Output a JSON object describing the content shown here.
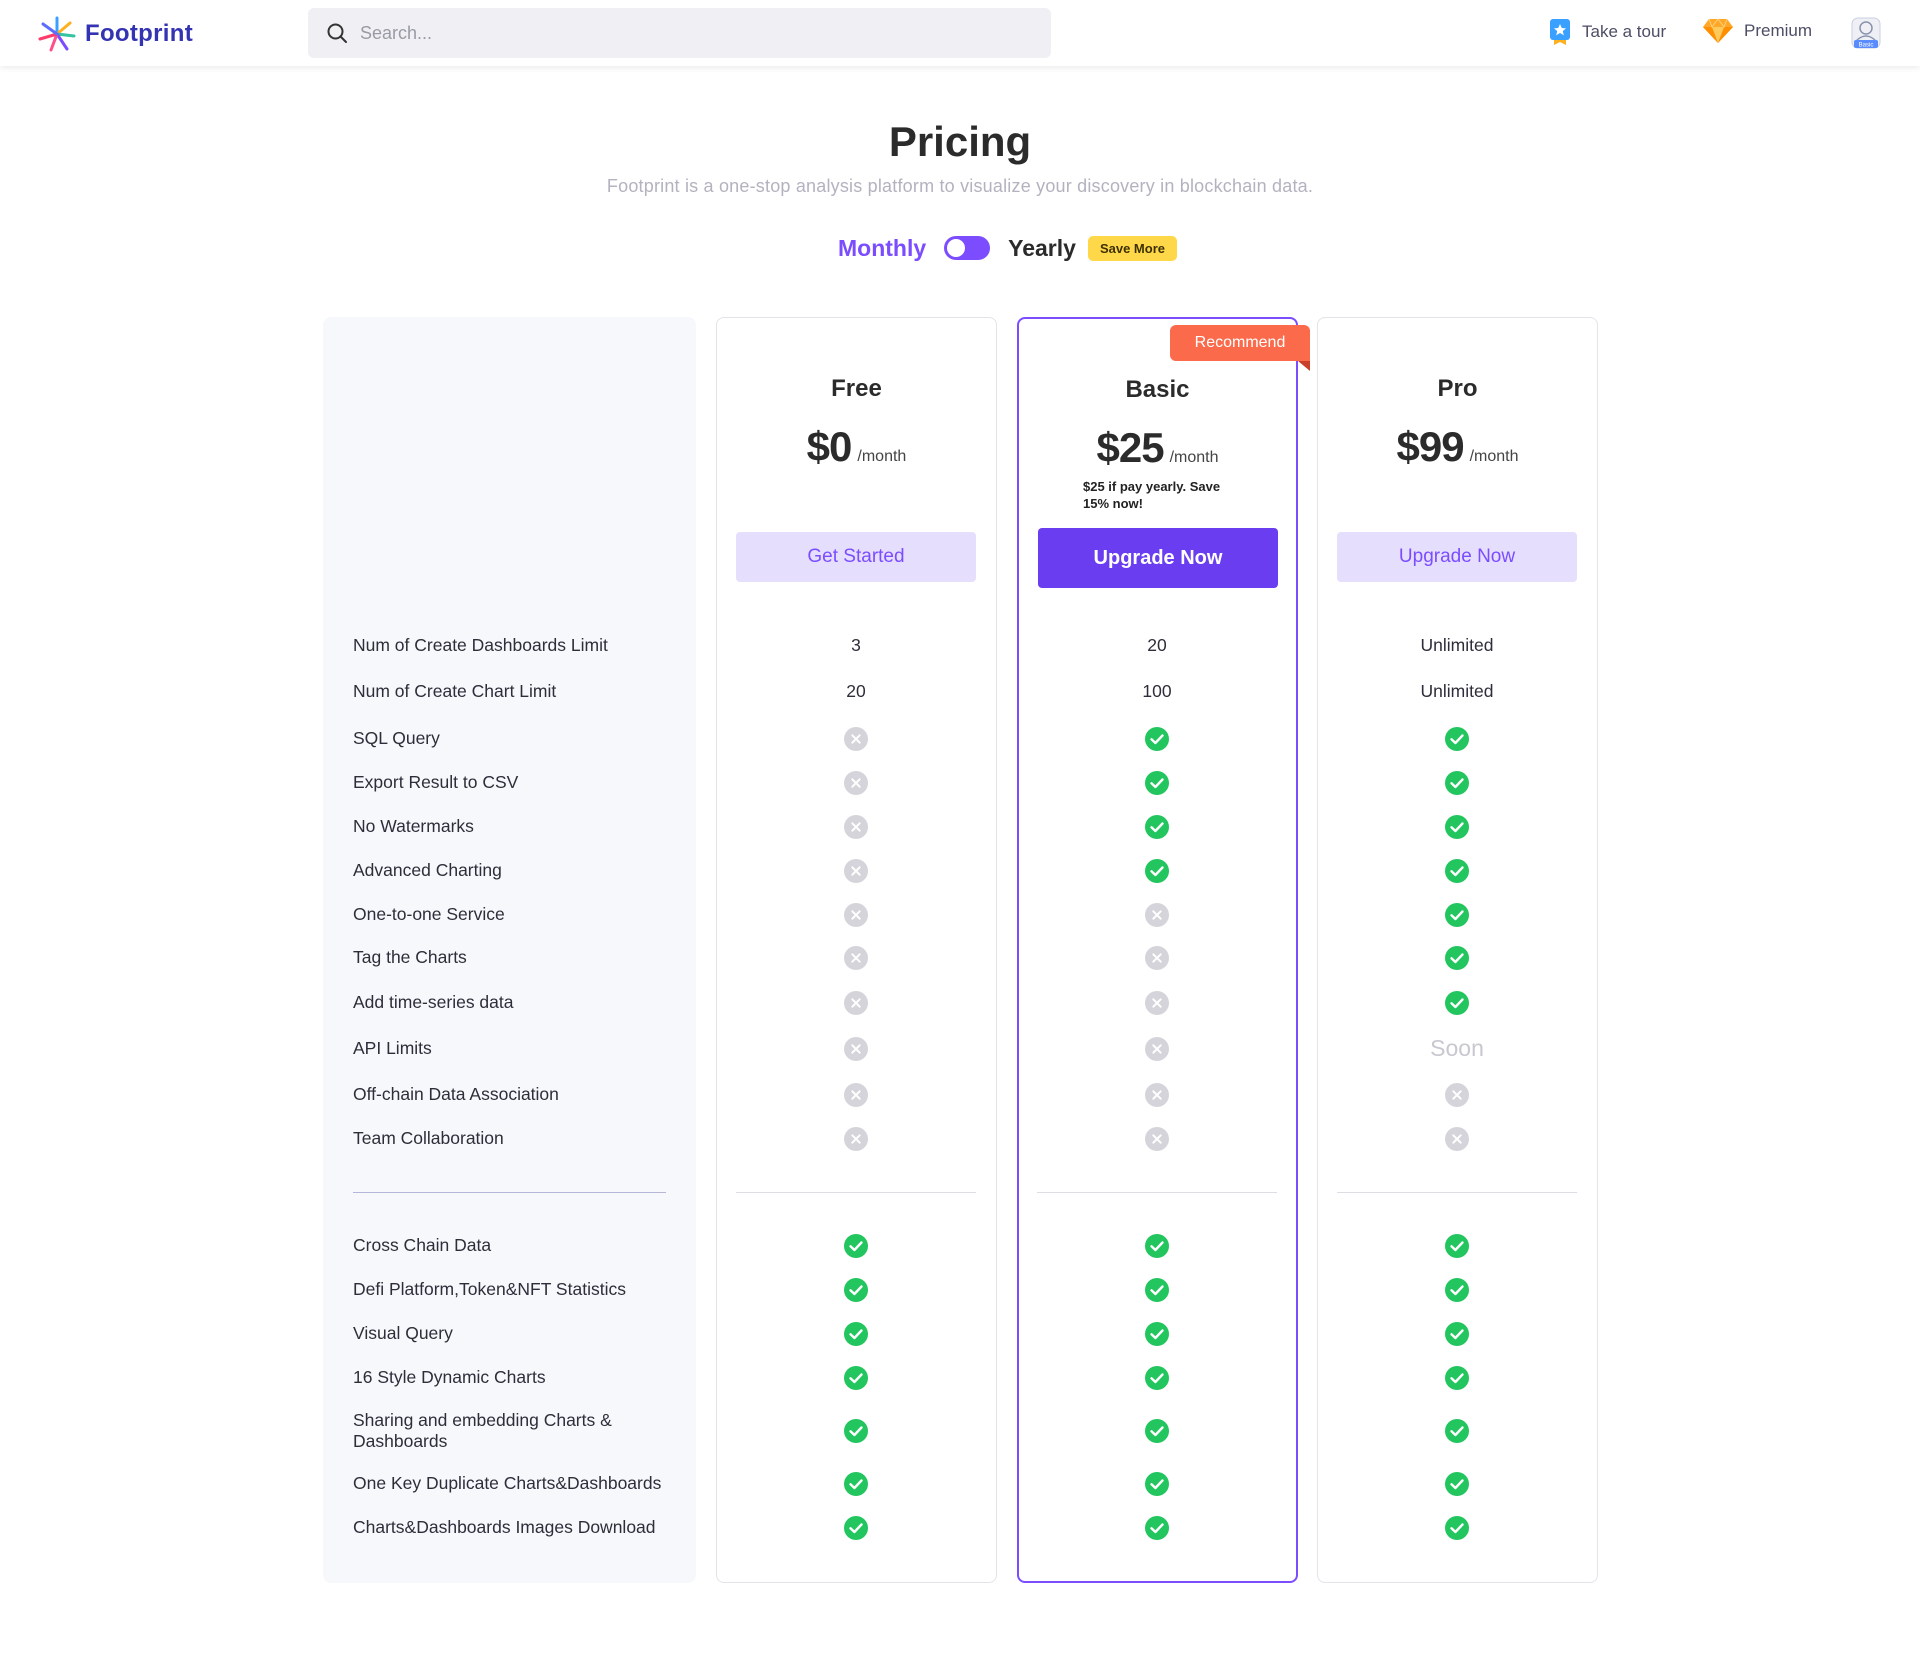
{
  "header": {
    "brand": "Footprint",
    "search_placeholder": "Search...",
    "take_tour": "Take a tour",
    "premium": "Premium",
    "avatar_badge": "Basic"
  },
  "page": {
    "title": "Pricing",
    "subtitle": "Footprint is a one-stop analysis platform to visualize your discovery in blockchain data.",
    "billing_monthly": "Monthly",
    "billing_yearly": "Yearly",
    "save_more": "Save More",
    "billing_toggle_yearly": false
  },
  "plans": {
    "free": {
      "name": "Free",
      "price": "$0",
      "unit": "/month",
      "button": "Get Started"
    },
    "basic": {
      "name": "Basic",
      "price": "$25",
      "unit": "/month",
      "note": "$25 if pay yearly. Save 15% now!",
      "button": "Upgrade Now",
      "badge": "Recommend"
    },
    "pro": {
      "name": "Pro",
      "price": "$99",
      "unit": "/month",
      "button": "Upgrade Now"
    }
  },
  "features": [
    {
      "label": "Num of Create Dashboards Limit",
      "free": "3",
      "basic": "20",
      "pro": "Unlimited"
    },
    {
      "label": "Num of Create Chart Limit",
      "free": "20",
      "basic": "100",
      "pro": "Unlimited"
    },
    {
      "label": "SQL Query",
      "free": "no",
      "basic": "yes",
      "pro": "yes"
    },
    {
      "label": "Export Result to CSV",
      "free": "no",
      "basic": "yes",
      "pro": "yes"
    },
    {
      "label": "No Watermarks",
      "free": "no",
      "basic": "yes",
      "pro": "yes"
    },
    {
      "label": "Advanced Charting",
      "free": "no",
      "basic": "yes",
      "pro": "yes"
    },
    {
      "label": "One-to-one Service",
      "free": "no",
      "basic": "no",
      "pro": "yes"
    },
    {
      "label": "Tag the Charts",
      "free": "no",
      "basic": "no",
      "pro": "yes"
    },
    {
      "label": "Add time-series data",
      "free": "no",
      "basic": "no",
      "pro": "yes"
    },
    {
      "label": "API Limits",
      "free": "no",
      "basic": "no",
      "pro": "Soon"
    },
    {
      "label": "Off-chain Data Association",
      "free": "no",
      "basic": "no",
      "pro": "no"
    },
    {
      "label": "Team Collaboration",
      "free": "no",
      "basic": "no",
      "pro": "no"
    }
  ],
  "common_features": [
    {
      "label": "Cross Chain Data",
      "free": "yes",
      "basic": "yes",
      "pro": "yes"
    },
    {
      "label": "Defi Platform,Token&NFT Statistics",
      "free": "yes",
      "basic": "yes",
      "pro": "yes"
    },
    {
      "label": "Visual Query",
      "free": "yes",
      "basic": "yes",
      "pro": "yes"
    },
    {
      "label": "16 Style Dynamic Charts",
      "free": "yes",
      "basic": "yes",
      "pro": "yes"
    },
    {
      "label": "Sharing and embedding Charts & Dashboards",
      "free": "yes",
      "basic": "yes",
      "pro": "yes"
    },
    {
      "label": "One Key Duplicate Charts&Dashboards",
      "free": "yes",
      "basic": "yes",
      "pro": "yes"
    },
    {
      "label": "Charts&Dashboards Images Download",
      "free": "yes",
      "basic": "yes",
      "pro": "yes"
    }
  ],
  "colors": {
    "accent": "#7b4dff",
    "button_primary": "#6a3ef0",
    "check_green": "#22c55e",
    "cross_gray": "#d4d4da",
    "recommend": "#fb6a4b",
    "save_badge": "#ffd84a"
  }
}
